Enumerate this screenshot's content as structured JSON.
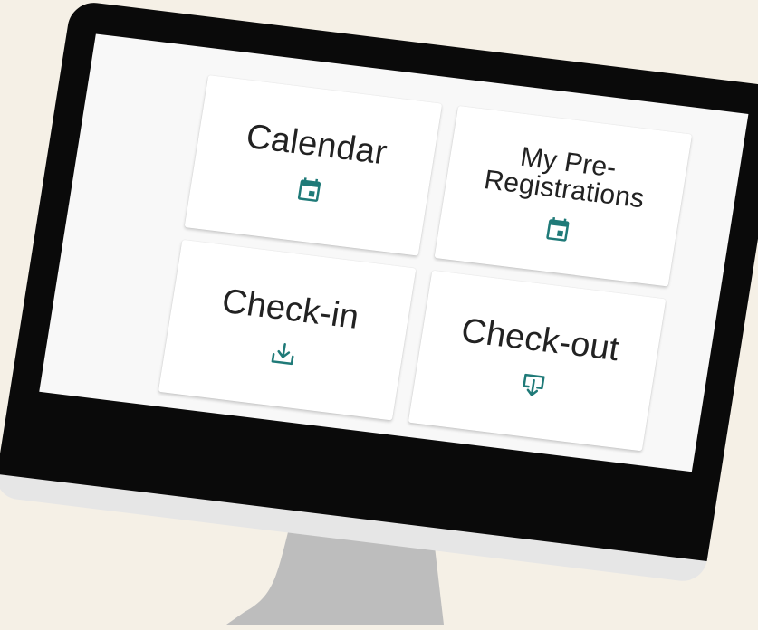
{
  "colors": {
    "background": "#f5f0e6",
    "bezel": "#0a0a0a",
    "chin": "#e6e6e6",
    "stand": "#bdbdbd",
    "screen": "#f8f8f8",
    "accent": "#1f7a78"
  },
  "tiles": [
    {
      "label": "Calendar",
      "icon": "calendar-icon"
    },
    {
      "label": "My Pre-Registrations",
      "icon": "calendar-icon"
    },
    {
      "label": "Check-in",
      "icon": "download-tray-icon"
    },
    {
      "label": "Check-out",
      "icon": "download-box-icon"
    }
  ]
}
